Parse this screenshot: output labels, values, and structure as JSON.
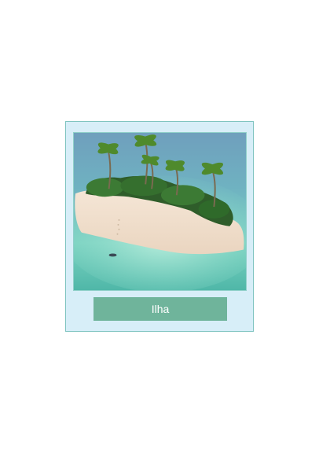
{
  "card": {
    "image_subject": "tropical-island-photo",
    "button_label": "Ilha",
    "colors": {
      "card_background": "#d7eef8",
      "card_border": "#7fc4c0",
      "button_background": "#6fb49b",
      "button_text": "#ffffff"
    }
  }
}
